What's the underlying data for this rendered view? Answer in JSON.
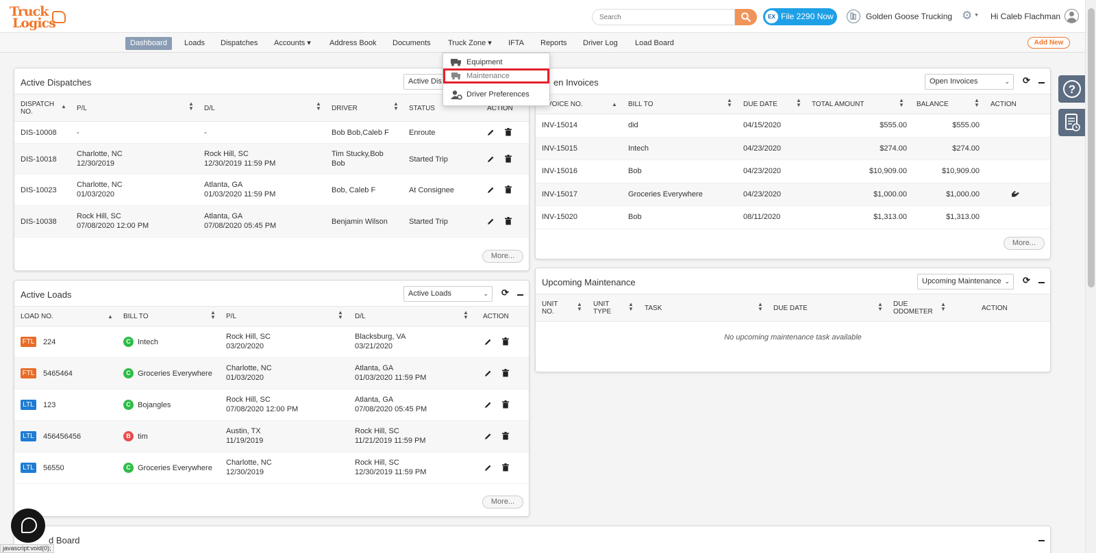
{
  "header": {
    "logo_top": "Truck",
    "logo_bottom": "Logics",
    "search_placeholder": "Search",
    "file_badge": "EX",
    "file_button": "File 2290 Now",
    "company": "Golden Goose Trucking",
    "greeting": "Hi Caleb Flachman"
  },
  "nav": {
    "items": [
      "Dashboard",
      "Loads",
      "Dispatches",
      "Accounts ▾",
      "Address Book",
      "Documents",
      "Truck Zone ▾",
      "IFTA",
      "Reports",
      "Driver Log",
      "Load Board"
    ],
    "add_new": "Add New"
  },
  "truck_zone_menu": {
    "items": [
      "Equipment",
      "Maintenance",
      "Driver Preferences"
    ]
  },
  "active_dispatches": {
    "title": "Active Dispatches",
    "select": "Active Dis",
    "headers": [
      "DISPATCH NO.",
      "P/L",
      "D/L",
      "DRIVER",
      "STATUS",
      "ACTION"
    ],
    "rows": [
      {
        "no": "DIS-10008",
        "pl1": "-",
        "pl2": "",
        "dl1": "-",
        "dl2": "",
        "driver1": "Bob Bob,Caleb F",
        "driver2": "",
        "status": "Enroute"
      },
      {
        "no": "DIS-10018",
        "pl1": "Charlotte, NC",
        "pl2": "12/30/2019",
        "dl1": "Rock Hill, SC",
        "dl2": "12/30/2019 11:59 PM",
        "driver1": "Tim Stucky,Bob",
        "driver2": "Bob",
        "status": "Started Trip"
      },
      {
        "no": "DIS-10023",
        "pl1": "Charlotte, NC",
        "pl2": "01/03/2020",
        "dl1": "Atlanta, GA",
        "dl2": "01/03/2020 11:59 PM",
        "driver1": "Bob, Caleb F",
        "driver2": "",
        "status": "At Consignee"
      },
      {
        "no": "DIS-10038",
        "pl1": "Rock Hill, SC",
        "pl2": "07/08/2020 12:00 PM",
        "dl1": "Atlanta, GA",
        "dl2": "07/08/2020 05:45 PM",
        "driver1": "Benjamin Wilson",
        "driver2": "",
        "status": "Started Trip"
      }
    ],
    "more": "More..."
  },
  "active_loads": {
    "title": "Active Loads",
    "select": "Active Loads",
    "headers": [
      "LOAD NO.",
      "BILL TO",
      "P/L",
      "D/L",
      "ACTION"
    ],
    "rows": [
      {
        "type": "FTL",
        "no": "224",
        "circle": "C",
        "bill_to": "Intech",
        "pl1": "Rock Hill, SC",
        "pl2": "03/20/2020",
        "dl1": "Blacksburg, VA",
        "dl2": "03/21/2020"
      },
      {
        "type": "FTL",
        "no": "5465464",
        "circle": "C",
        "bill_to": "Groceries Everywhere",
        "pl1": "Charlotte, NC",
        "pl2": "01/03/2020",
        "dl1": "Atlanta, GA",
        "dl2": "01/03/2020 11:59 PM"
      },
      {
        "type": "LTL",
        "no": "123",
        "circle": "C",
        "bill_to": "Bojangles",
        "pl1": "Rock Hill, SC",
        "pl2": "07/08/2020 12:00 PM",
        "dl1": "Atlanta, GA",
        "dl2": "07/08/2020 05:45 PM"
      },
      {
        "type": "LTL",
        "no": "456456456",
        "circle": "B",
        "bill_to": "tim",
        "pl1": "Austin, TX",
        "pl2": "11/19/2019",
        "dl1": "Rock Hill, SC",
        "dl2": "11/21/2019 11:59 PM"
      },
      {
        "type": "LTL",
        "no": "56550",
        "circle": "C",
        "bill_to": "Groceries Everywhere",
        "pl1": "Charlotte, NC",
        "pl2": "12/30/2019",
        "dl1": "Rock Hill, SC",
        "dl2": "12/30/2019 11:59 PM"
      }
    ],
    "more": "More..."
  },
  "open_invoices": {
    "title": "en Invoices",
    "select": "Open Invoices",
    "headers": [
      "VOICE NO.",
      "BILL TO",
      "DUE DATE",
      "TOTAL AMOUNT",
      "BALANCE",
      "ACTION"
    ],
    "rows": [
      {
        "no": "INV-15014",
        "bill_to": "did",
        "due": "04/15/2020",
        "total": "$555.00",
        "balance": "$555.00"
      },
      {
        "no": "INV-15015",
        "bill_to": "Intech",
        "due": "04/23/2020",
        "total": "$274.00",
        "balance": "$274.00"
      },
      {
        "no": "INV-15016",
        "bill_to": "Bob",
        "due": "04/23/2020",
        "total": "$10,909.00",
        "balance": "$10,909.00"
      },
      {
        "no": "INV-15017",
        "bill_to": "Groceries Everywhere",
        "due": "04/23/2020",
        "total": "$1,000.00",
        "balance": "$1,000.00"
      },
      {
        "no": "INV-15020",
        "bill_to": "Bob",
        "due": "08/11/2020",
        "total": "$1,313.00",
        "balance": "$1,313.00"
      }
    ],
    "more": "More..."
  },
  "upcoming_maintenance": {
    "title": "Upcoming Maintenance",
    "select": "Upcoming Maintenance",
    "headers": [
      "UNIT NO.",
      "UNIT TYPE",
      "TASK",
      "DUE DATE",
      "DUE ODOMETER",
      "ACTION"
    ],
    "empty": "No upcoming maintenance task available"
  },
  "load_board": {
    "title": "d Board"
  },
  "status_bar": "javascript:void(0);"
}
